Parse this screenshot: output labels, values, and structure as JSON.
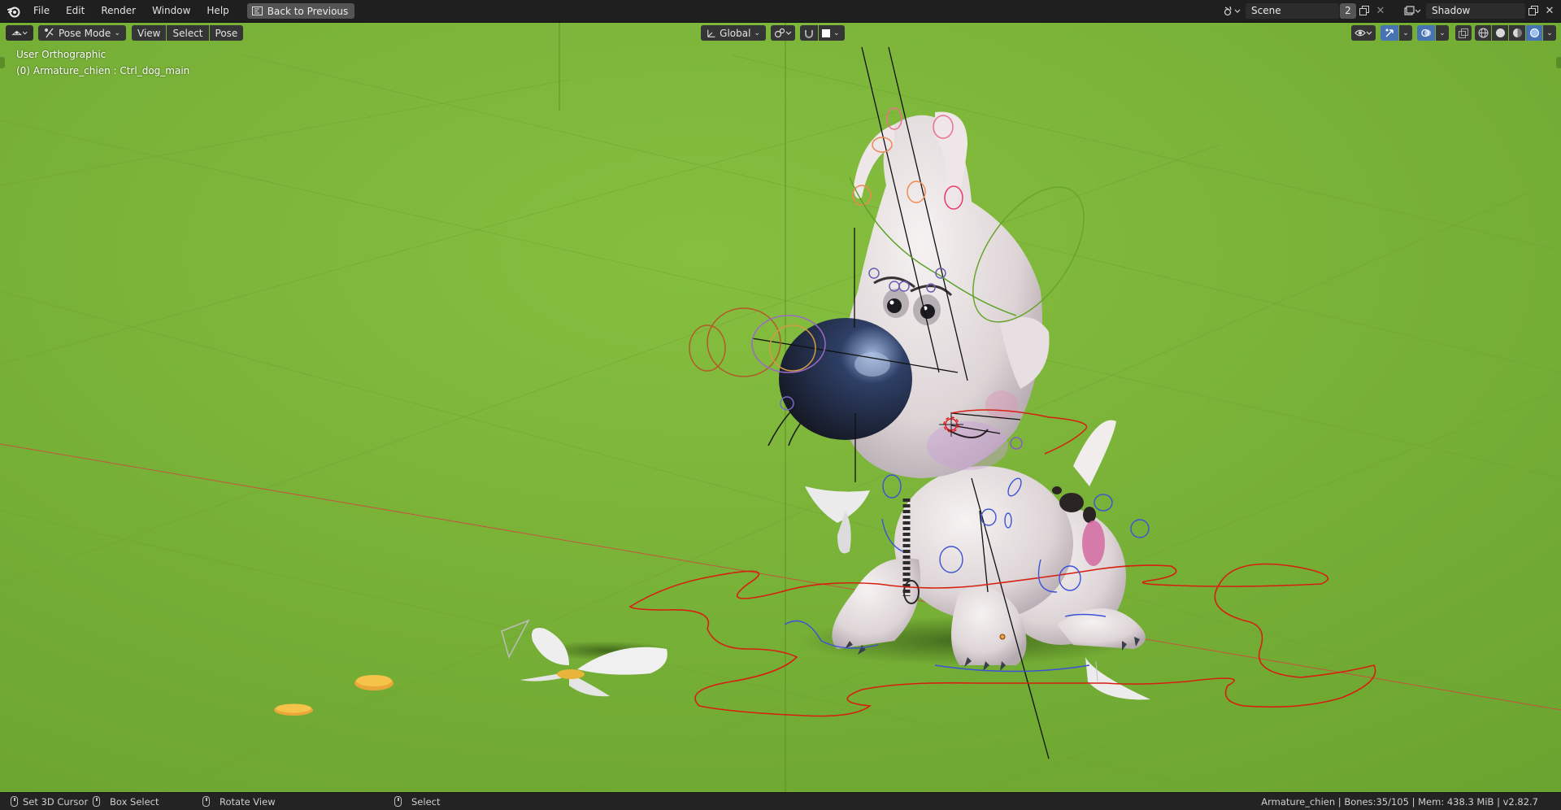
{
  "menubar": {
    "items": [
      "File",
      "Edit",
      "Render",
      "Window",
      "Help"
    ],
    "back_button": "Back to Previous"
  },
  "scene_selector": {
    "value": "Scene",
    "users_count": "2"
  },
  "view_layer_selector": {
    "value": "Shadow"
  },
  "viewport_header": {
    "mode": "Pose Mode",
    "menus": [
      "View",
      "Select",
      "Pose"
    ],
    "orientation": "Global"
  },
  "viewport_overlay": {
    "view_name": "User Orthographic",
    "active_object": "(0) Armature_chien : Ctrl_dog_main"
  },
  "statusbar": {
    "set_cursor": "Set 3D Cursor",
    "box_select": "Box Select",
    "rotate_view": "Rotate View",
    "select": "Select",
    "stats": "Armature_chien | Bones:35/105 | Mem: 438.3 MiB | v2.82.7"
  },
  "colors": {
    "viewport_bg": "#78b138",
    "accent": "#4772b3",
    "header_bg": "#1f1f1f"
  }
}
